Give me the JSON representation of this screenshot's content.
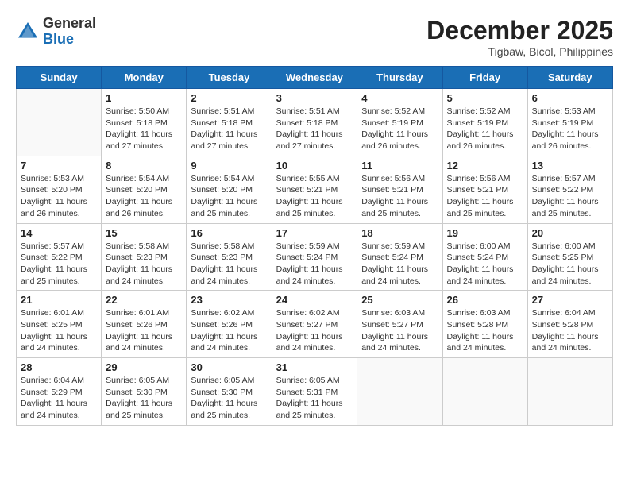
{
  "header": {
    "logo_general": "General",
    "logo_blue": "Blue",
    "month_year": "December 2025",
    "location": "Tigbaw, Bicol, Philippines"
  },
  "weekdays": [
    "Sunday",
    "Monday",
    "Tuesday",
    "Wednesday",
    "Thursday",
    "Friday",
    "Saturday"
  ],
  "weeks": [
    [
      {
        "day": "",
        "info": ""
      },
      {
        "day": "1",
        "info": "Sunrise: 5:50 AM\nSunset: 5:18 PM\nDaylight: 11 hours\nand 27 minutes."
      },
      {
        "day": "2",
        "info": "Sunrise: 5:51 AM\nSunset: 5:18 PM\nDaylight: 11 hours\nand 27 minutes."
      },
      {
        "day": "3",
        "info": "Sunrise: 5:51 AM\nSunset: 5:18 PM\nDaylight: 11 hours\nand 27 minutes."
      },
      {
        "day": "4",
        "info": "Sunrise: 5:52 AM\nSunset: 5:19 PM\nDaylight: 11 hours\nand 26 minutes."
      },
      {
        "day": "5",
        "info": "Sunrise: 5:52 AM\nSunset: 5:19 PM\nDaylight: 11 hours\nand 26 minutes."
      },
      {
        "day": "6",
        "info": "Sunrise: 5:53 AM\nSunset: 5:19 PM\nDaylight: 11 hours\nand 26 minutes."
      }
    ],
    [
      {
        "day": "7",
        "info": "Sunrise: 5:53 AM\nSunset: 5:20 PM\nDaylight: 11 hours\nand 26 minutes."
      },
      {
        "day": "8",
        "info": "Sunrise: 5:54 AM\nSunset: 5:20 PM\nDaylight: 11 hours\nand 26 minutes."
      },
      {
        "day": "9",
        "info": "Sunrise: 5:54 AM\nSunset: 5:20 PM\nDaylight: 11 hours\nand 25 minutes."
      },
      {
        "day": "10",
        "info": "Sunrise: 5:55 AM\nSunset: 5:21 PM\nDaylight: 11 hours\nand 25 minutes."
      },
      {
        "day": "11",
        "info": "Sunrise: 5:56 AM\nSunset: 5:21 PM\nDaylight: 11 hours\nand 25 minutes."
      },
      {
        "day": "12",
        "info": "Sunrise: 5:56 AM\nSunset: 5:21 PM\nDaylight: 11 hours\nand 25 minutes."
      },
      {
        "day": "13",
        "info": "Sunrise: 5:57 AM\nSunset: 5:22 PM\nDaylight: 11 hours\nand 25 minutes."
      }
    ],
    [
      {
        "day": "14",
        "info": "Sunrise: 5:57 AM\nSunset: 5:22 PM\nDaylight: 11 hours\nand 25 minutes."
      },
      {
        "day": "15",
        "info": "Sunrise: 5:58 AM\nSunset: 5:23 PM\nDaylight: 11 hours\nand 24 minutes."
      },
      {
        "day": "16",
        "info": "Sunrise: 5:58 AM\nSunset: 5:23 PM\nDaylight: 11 hours\nand 24 minutes."
      },
      {
        "day": "17",
        "info": "Sunrise: 5:59 AM\nSunset: 5:24 PM\nDaylight: 11 hours\nand 24 minutes."
      },
      {
        "day": "18",
        "info": "Sunrise: 5:59 AM\nSunset: 5:24 PM\nDaylight: 11 hours\nand 24 minutes."
      },
      {
        "day": "19",
        "info": "Sunrise: 6:00 AM\nSunset: 5:24 PM\nDaylight: 11 hours\nand 24 minutes."
      },
      {
        "day": "20",
        "info": "Sunrise: 6:00 AM\nSunset: 5:25 PM\nDaylight: 11 hours\nand 24 minutes."
      }
    ],
    [
      {
        "day": "21",
        "info": "Sunrise: 6:01 AM\nSunset: 5:25 PM\nDaylight: 11 hours\nand 24 minutes."
      },
      {
        "day": "22",
        "info": "Sunrise: 6:01 AM\nSunset: 5:26 PM\nDaylight: 11 hours\nand 24 minutes."
      },
      {
        "day": "23",
        "info": "Sunrise: 6:02 AM\nSunset: 5:26 PM\nDaylight: 11 hours\nand 24 minutes."
      },
      {
        "day": "24",
        "info": "Sunrise: 6:02 AM\nSunset: 5:27 PM\nDaylight: 11 hours\nand 24 minutes."
      },
      {
        "day": "25",
        "info": "Sunrise: 6:03 AM\nSunset: 5:27 PM\nDaylight: 11 hours\nand 24 minutes."
      },
      {
        "day": "26",
        "info": "Sunrise: 6:03 AM\nSunset: 5:28 PM\nDaylight: 11 hours\nand 24 minutes."
      },
      {
        "day": "27",
        "info": "Sunrise: 6:04 AM\nSunset: 5:28 PM\nDaylight: 11 hours\nand 24 minutes."
      }
    ],
    [
      {
        "day": "28",
        "info": "Sunrise: 6:04 AM\nSunset: 5:29 PM\nDaylight: 11 hours\nand 24 minutes."
      },
      {
        "day": "29",
        "info": "Sunrise: 6:05 AM\nSunset: 5:30 PM\nDaylight: 11 hours\nand 25 minutes."
      },
      {
        "day": "30",
        "info": "Sunrise: 6:05 AM\nSunset: 5:30 PM\nDaylight: 11 hours\nand 25 minutes."
      },
      {
        "day": "31",
        "info": "Sunrise: 6:05 AM\nSunset: 5:31 PM\nDaylight: 11 hours\nand 25 minutes."
      },
      {
        "day": "",
        "info": ""
      },
      {
        "day": "",
        "info": ""
      },
      {
        "day": "",
        "info": ""
      }
    ]
  ]
}
